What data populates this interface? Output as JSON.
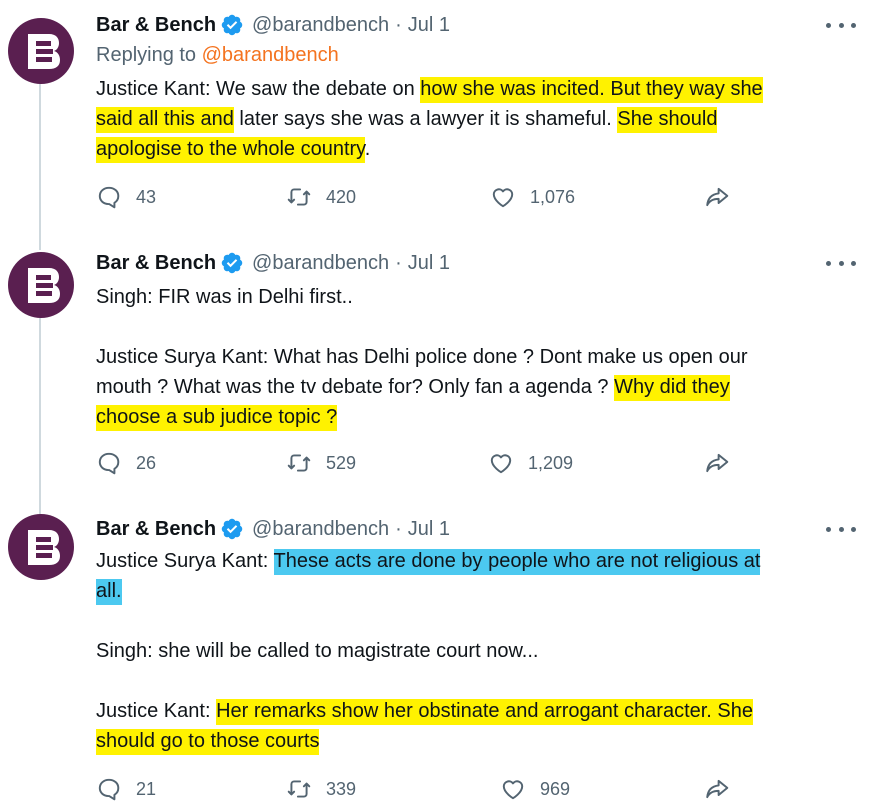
{
  "tweets": [
    {
      "name": "Bar & Bench",
      "handle": "@barandbench",
      "dot": "·",
      "date": "Jul 1",
      "replying_prefix": "Replying to ",
      "replying_to": "@barandbench",
      "lines": [
        [
          {
            "t": "Justice Kant: We saw the debate on ",
            "h": ""
          },
          {
            "t": "how she was incited. But they way she",
            "h": "y"
          }
        ],
        [
          {
            "t": "said all this and",
            "h": "y"
          },
          {
            "t": " later says she was a lawyer it is shameful. ",
            "h": ""
          },
          {
            "t": "She should",
            "h": "y"
          }
        ],
        [
          {
            "t": "apologise to the whole country",
            "h": "y"
          },
          {
            "t": ".",
            "h": ""
          }
        ]
      ],
      "replies": "43",
      "retweets": "420",
      "likes": "1,076"
    },
    {
      "name": "Bar & Bench",
      "handle": "@barandbench",
      "dot": "·",
      "date": "Jul 1",
      "lines": [
        [
          {
            "t": "Singh: FIR was in Delhi first..",
            "h": ""
          }
        ],
        [],
        [
          {
            "t": "Justice Surya Kant: What has Delhi police done ? Dont make us open our",
            "h": ""
          }
        ],
        [
          {
            "t": "mouth ? What was the tv debate for? Only fan a agenda ? ",
            "h": ""
          },
          {
            "t": "Why did they",
            "h": "y"
          }
        ],
        [
          {
            "t": "choose a sub judice topic ?",
            "h": "y"
          }
        ]
      ],
      "replies": "26",
      "retweets": "529",
      "likes": "1,209"
    },
    {
      "name": "Bar & Bench",
      "handle": "@barandbench",
      "dot": "·",
      "date": "Jul 1",
      "lines": [
        [
          {
            "t": "Justice Surya Kant: ",
            "h": ""
          },
          {
            "t": "These acts are done by people who are not religious at",
            "h": "b"
          }
        ],
        [
          {
            "t": "all.",
            "h": "b"
          }
        ],
        [],
        [
          {
            "t": "Singh: she will be called to magistrate court now...",
            "h": ""
          }
        ],
        [],
        [
          {
            "t": "Justice Kant: ",
            "h": ""
          },
          {
            "t": "Her remarks show her obstinate and arrogant character. She",
            "h": "y"
          }
        ],
        [
          {
            "t": "should go to those courts",
            "h": "y"
          }
        ]
      ],
      "replies": "21",
      "retweets": "339",
      "likes": "969"
    }
  ],
  "icons": {
    "avatar": "bar-and-bench-logo",
    "verified": "verified-badge-icon",
    "more": "more-options-icon",
    "reply": "reply-icon",
    "retweet": "retweet-icon",
    "like": "like-icon",
    "share": "share-icon"
  },
  "colors": {
    "avatar_bg": "#5a1f50",
    "verified": "#1d9bf0",
    "mention": "#f4731f",
    "highlight_yellow": "#fff200",
    "highlight_blue": "#4cc9f0",
    "secondary_text": "#536471"
  }
}
